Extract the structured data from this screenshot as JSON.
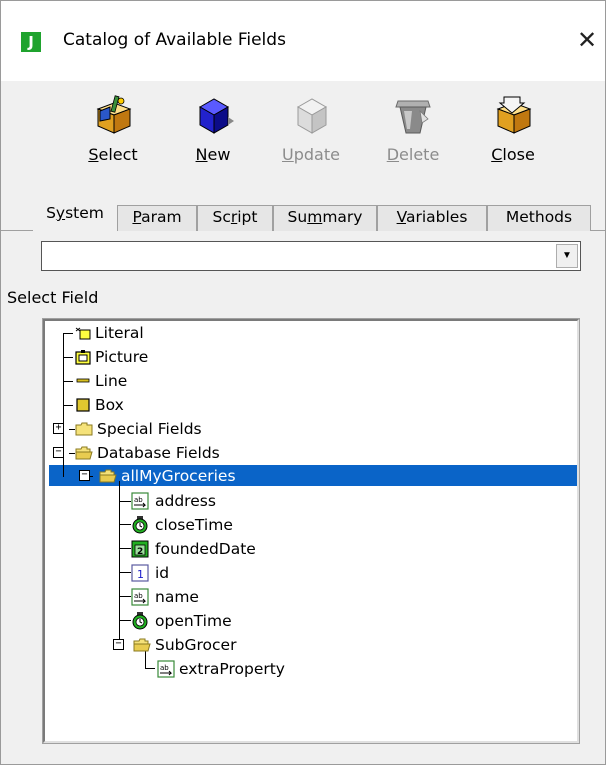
{
  "window": {
    "title": "Catalog of Available Fields",
    "app_icon_letter": "J",
    "close_glyph": "✕"
  },
  "toolbar": {
    "select": {
      "pre": "",
      "u": "S",
      "post": "elect",
      "enabled": true,
      "icon": "select-box-icon"
    },
    "new": {
      "pre": "",
      "u": "N",
      "post": "ew",
      "enabled": true,
      "icon": "blue-cube-icon"
    },
    "update": {
      "pre": "",
      "u": "U",
      "post": "pdate",
      "enabled": false,
      "icon": "gray-cube-icon"
    },
    "delete": {
      "pre": "",
      "u": "D",
      "post": "elete",
      "enabled": false,
      "icon": "trash-bin-icon"
    },
    "close": {
      "pre": "",
      "u": "C",
      "post": "lose",
      "enabled": true,
      "icon": "box-arrow-icon"
    }
  },
  "tabs": [
    {
      "pre": "S",
      "u": "y",
      "post": "stem",
      "active": true
    },
    {
      "pre": "",
      "u": "P",
      "post": "aram",
      "active": false
    },
    {
      "pre": "Sc",
      "u": "r",
      "post": "ipt",
      "active": false
    },
    {
      "pre": "Su",
      "u": "m",
      "post": "mary",
      "active": false
    },
    {
      "pre": "",
      "u": "V",
      "post": "ariables",
      "active": false
    },
    {
      "pre": "Methods",
      "u": "",
      "post": "",
      "active": false
    }
  ],
  "combo": {
    "value": "",
    "arrow": "▼"
  },
  "select_field_label": "Select Field",
  "tree": {
    "items": [
      {
        "label": "Literal",
        "icon": "literal-icon"
      },
      {
        "label": "Picture",
        "icon": "picture-icon"
      },
      {
        "label": "Line",
        "icon": "line-icon"
      },
      {
        "label": "Box",
        "icon": "box-icon"
      },
      {
        "label": "Special Fields",
        "icon": "folder-icon",
        "expander": "+"
      },
      {
        "label": "Database Fields",
        "icon": "open-folder-icon",
        "expander": "−"
      },
      {
        "label": "allMyGroceries",
        "icon": "open-folder-icon",
        "expander": "−",
        "selected": true
      },
      {
        "label": "address",
        "icon": "text-field-icon"
      },
      {
        "label": "closeTime",
        "icon": "time-field-icon"
      },
      {
        "label": "foundedDate",
        "icon": "date-field-icon"
      },
      {
        "label": "id",
        "icon": "number-field-icon",
        "glyph": "1"
      },
      {
        "label": "name",
        "icon": "text-field-icon"
      },
      {
        "label": "openTime",
        "icon": "time-field-icon"
      },
      {
        "label": "SubGrocer",
        "icon": "open-folder-icon",
        "expander": "−"
      },
      {
        "label": "extraProperty",
        "icon": "text-field-icon"
      }
    ]
  },
  "colors": {
    "selection": "#0a64c8",
    "app_icon": "#1fa32e",
    "disabled_text": "#8c8c8c"
  }
}
